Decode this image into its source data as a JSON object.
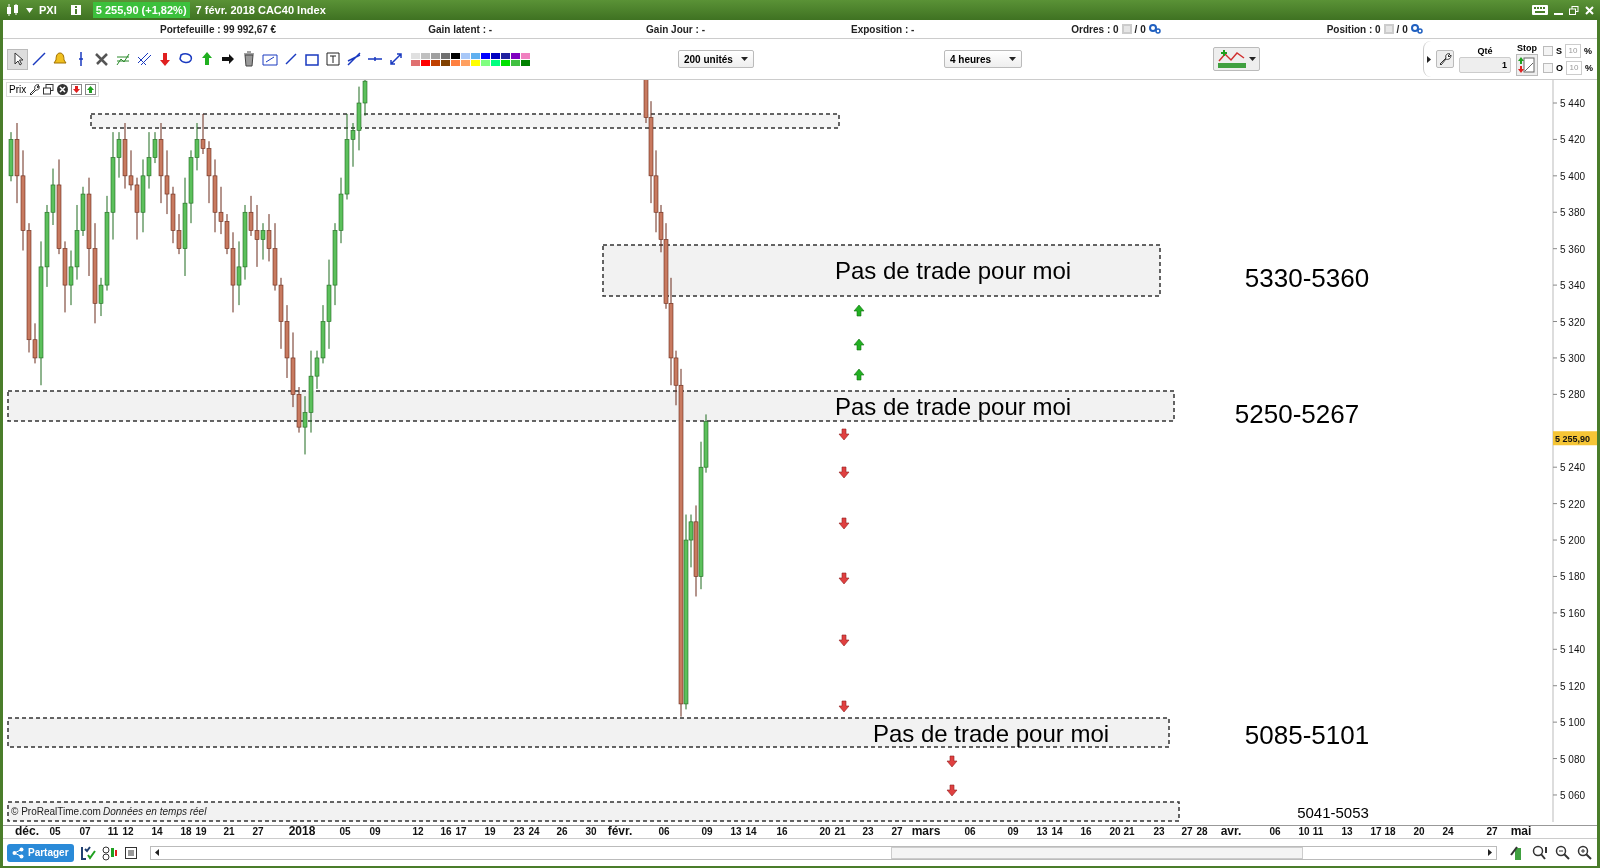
{
  "title_bar": {
    "instrument": "PXI",
    "quote": "5 255,90 (+1,82%)",
    "description": "7 févr. 2018 CAC40 Index"
  },
  "account_bar": [
    {
      "kind": "text",
      "label": "Portefeuille : 99 992,67 €"
    },
    {
      "kind": "text",
      "label": "Gain latent : -"
    },
    {
      "kind": "text",
      "label": "Gain Jour : -"
    },
    {
      "kind": "text",
      "label": "Exposition : -"
    },
    {
      "kind": "orders",
      "label": "Ordres : 0",
      "count": "/ 0"
    },
    {
      "kind": "orders",
      "label": "Position : 0",
      "count": "/ 0"
    }
  ],
  "toolbar": {
    "palette": [
      {
        "color": "#e0e0e0"
      },
      {
        "color": "#c0c0c0"
      },
      {
        "color": "#a0a0a0"
      },
      {
        "color": "#707070"
      },
      {
        "color": "#000000"
      },
      {
        "color": "#a8c8f8"
      },
      {
        "color": "#60b0f0"
      },
      {
        "color": "#0000ff"
      },
      {
        "color": "#0000c0"
      },
      {
        "color": "#2020a0"
      },
      {
        "color": "#8000c0"
      },
      {
        "color": "#f080c0"
      },
      {
        "color": "#e07070"
      },
      {
        "color": "#ff0000"
      },
      {
        "color": "#c04000"
      },
      {
        "color": "#804000"
      },
      {
        "color": "#ff8040"
      },
      {
        "color": "#ffa060"
      },
      {
        "color": "#ffff00"
      },
      {
        "color": "#80ff80"
      },
      {
        "color": "#00ff80"
      },
      {
        "color": "#00e000"
      },
      {
        "color": "#40c040"
      },
      {
        "color": "#008000"
      }
    ],
    "units": "200 unités",
    "timeframe": "4 heures",
    "qty_label": "Qté",
    "qty": "1",
    "stop_label": "Stop",
    "options": [
      {
        "label": "S",
        "checked": false,
        "value": "10",
        "unit": "%"
      },
      {
        "label": "O",
        "checked": false,
        "value": "10",
        "unit": "%"
      }
    ]
  },
  "chart": {
    "panel_label": "Prix",
    "price_ticks": [
      "5 440",
      "5 420",
      "5 400",
      "5 380",
      "5 360",
      "5 340",
      "5 320",
      "5 300",
      "5 280",
      "5 240",
      "5 220",
      "5 200",
      "5 180",
      "5 160",
      "5 140",
      "5 120",
      "5 100",
      "5 080",
      "5 060"
    ],
    "current_price": "5 255,90",
    "zones": [
      {
        "note": "Pas de trade pour moi",
        "range": "5330-5360"
      },
      {
        "note": "Pas de trade pour moi",
        "range": "5250-5267"
      },
      {
        "note": "Pas de trade pour moi",
        "range": "5085-5101"
      },
      {
        "range": "5041-5053"
      }
    ],
    "arrows": [
      {
        "kind": "up"
      },
      {
        "kind": "up"
      },
      {
        "kind": "up"
      },
      {
        "kind": "down"
      },
      {
        "kind": "down"
      },
      {
        "kind": "down"
      },
      {
        "kind": "down"
      },
      {
        "kind": "down"
      },
      {
        "kind": "down"
      },
      {
        "kind": "down"
      },
      {
        "kind": "down"
      }
    ],
    "footer": {
      "source": "© ProRealTime.com",
      "note": "Données en temps réel"
    },
    "date_ticks": [
      {
        "label": "déc.",
        "major": true
      },
      {
        "label": "05",
        "major": false
      },
      {
        "label": "07",
        "major": false
      },
      {
        "label": "11",
        "major": false
      },
      {
        "label": "12",
        "major": false
      },
      {
        "label": "14",
        "major": false
      },
      {
        "label": "18",
        "major": false
      },
      {
        "label": "19",
        "major": false
      },
      {
        "label": "21",
        "major": false
      },
      {
        "label": "27",
        "major": false
      },
      {
        "label": "2018",
        "major": true
      },
      {
        "label": "05",
        "major": false
      },
      {
        "label": "09",
        "major": false
      },
      {
        "label": "12",
        "major": false
      },
      {
        "label": "16",
        "major": false
      },
      {
        "label": "17",
        "major": false
      },
      {
        "label": "19",
        "major": false
      },
      {
        "label": "23",
        "major": false
      },
      {
        "label": "24",
        "major": false
      },
      {
        "label": "26",
        "major": false
      },
      {
        "label": "30",
        "major": false
      },
      {
        "label": "févr.",
        "major": true
      },
      {
        "label": "06",
        "major": false
      },
      {
        "label": "09",
        "major": false
      },
      {
        "label": "13",
        "major": false
      },
      {
        "label": "14",
        "major": false
      },
      {
        "label": "16",
        "major": false
      },
      {
        "label": "20",
        "major": false
      },
      {
        "label": "21",
        "major": false
      },
      {
        "label": "23",
        "major": false
      },
      {
        "label": "27",
        "major": false
      },
      {
        "label": "mars",
        "major": true
      },
      {
        "label": "06",
        "major": false
      },
      {
        "label": "09",
        "major": false
      },
      {
        "label": "13",
        "major": false
      },
      {
        "label": "14",
        "major": false
      },
      {
        "label": "16",
        "major": false
      },
      {
        "label": "20",
        "major": false
      },
      {
        "label": "21",
        "major": false
      },
      {
        "label": "23",
        "major": false
      },
      {
        "label": "27",
        "major": false
      },
      {
        "label": "28",
        "major": false
      },
      {
        "label": "avr.",
        "major": true
      },
      {
        "label": "06",
        "major": false
      },
      {
        "label": "10",
        "major": false
      },
      {
        "label": "11",
        "major": false
      },
      {
        "label": "13",
        "major": false
      },
      {
        "label": "17",
        "major": false
      },
      {
        "label": "18",
        "major": false
      },
      {
        "label": "20",
        "major": false
      },
      {
        "label": "24",
        "major": false
      },
      {
        "label": "27",
        "major": false
      },
      {
        "label": "mai",
        "major": true
      }
    ]
  },
  "bottom_bar": {
    "share": "Partager"
  }
}
